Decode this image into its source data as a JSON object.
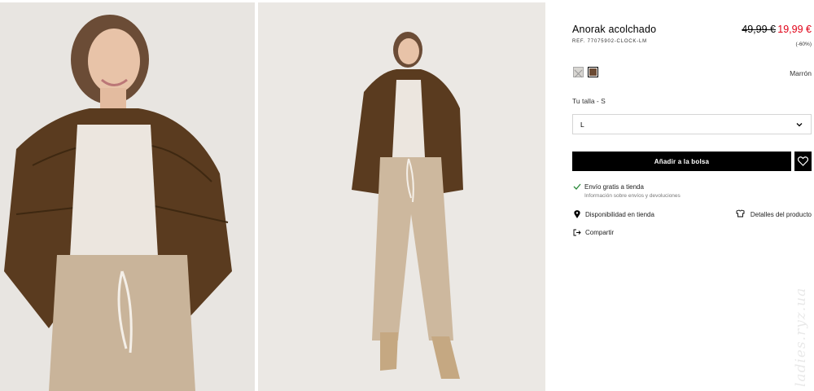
{
  "product": {
    "title": "Anorak acolchado",
    "reference": "REF. 77075902-CLOCK-LM",
    "price_original": "49,99 €",
    "price_current": "19,99 €",
    "discount": "(-60%)",
    "colors": [
      "light grey",
      "brown"
    ],
    "selected_color_name": "Marrón",
    "size_label": "Tu talla - S",
    "size_selected": "L",
    "add_to_bag": "Añadir a la bolsa"
  },
  "info": {
    "shipping_title": "Envío gratis a tienda",
    "shipping_sub": "Información sobre envíos y devoluciones",
    "store_availability": "Disponibilidad en tienda",
    "product_details": "Detalles del producto",
    "share": "Compartir"
  },
  "watermark": "ladies.ryz.ua",
  "icons": [
    "check-icon",
    "location-pin-icon",
    "hanger-icon",
    "share-icon",
    "heart-icon",
    "chevron-down-icon"
  ],
  "colors_ui": {
    "accent_sale": "#e00016",
    "button": "#000000"
  }
}
